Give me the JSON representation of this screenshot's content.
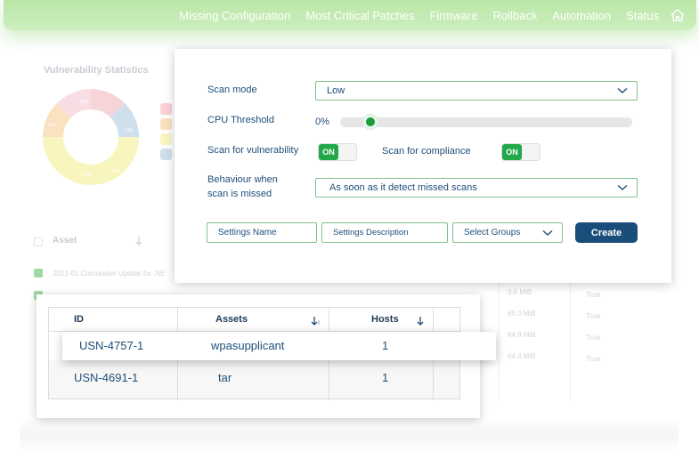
{
  "nav": {
    "items": [
      "Missing Configuration",
      "Most Critical Patches",
      "Firmware",
      "Rollback",
      "Automation",
      "Status"
    ],
    "home_icon": "home-icon"
  },
  "background": {
    "stats_title": "Vulnerability Statistics",
    "donut_labels": [
      "10%",
      "13%",
      "13%",
      "14%",
      "50%"
    ],
    "table_headers": [
      "Asset"
    ],
    "rows": [
      {
        "name": "2021-01 Cumulative Update for .NE",
        "size": "",
        "flag": ""
      },
      {
        "name": "",
        "size": "3.6 MiB",
        "flag": "True"
      },
      {
        "name": "",
        "size": "65.0 MiB",
        "flag": "True"
      },
      {
        "name": "",
        "size": "64.9 MiB",
        "flag": "True"
      },
      {
        "name": "",
        "size": "64.4 MiB",
        "flag": "True"
      }
    ]
  },
  "dialog": {
    "scan_mode_label": "Scan mode",
    "scan_mode_value": "Low",
    "cpu_label": "CPU Threshold",
    "cpu_value": "0%",
    "cpu_fraction": 0.1,
    "scan_vuln_label": "Scan for vulnerability",
    "scan_vuln_toggle": "ON",
    "scan_compliance_label": "Scan for compliance",
    "scan_compliance_toggle": "ON",
    "behaviour_label_1": "Behaviour when",
    "behaviour_label_2": "scan is missed",
    "behaviour_value": "As soon as it detect missed scans",
    "settings_name_placeholder": "Settings Name",
    "settings_desc_placeholder": "Settings Description",
    "groups_placeholder": "Select Groups",
    "create_label": "Create"
  },
  "table": {
    "headers": {
      "id": "ID",
      "assets": "Assets",
      "hosts": "Hosts"
    },
    "rows": [
      {
        "id": "USN-4757-1",
        "asset": "wpasupplicant",
        "hosts": "1"
      },
      {
        "id": "USN-4691-1",
        "asset": "tar",
        "hosts": "1"
      }
    ]
  },
  "colors": {
    "accent_green": "#22a84a",
    "primary_blue": "#1b4d7a",
    "text_blue": "#1f4e79",
    "nav_green": "#b9e7a6"
  }
}
